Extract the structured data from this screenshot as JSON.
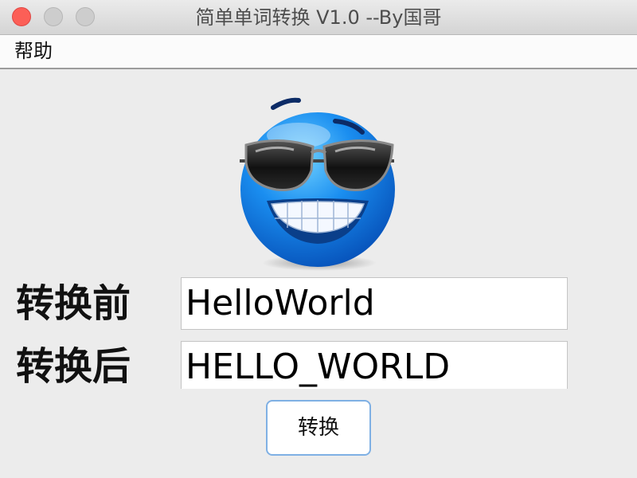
{
  "window": {
    "title": "简单单词转换 V1.0 --By国哥"
  },
  "menubar": {
    "items": [
      {
        "label": "帮助"
      }
    ]
  },
  "form": {
    "before_label": "转换前",
    "before_value": "HelloWorld",
    "after_label": "转换后",
    "after_value": "HELLO_WORLD",
    "convert_button": "转换"
  },
  "icons": {
    "mascot": "cool-sunglasses-smiley-icon"
  },
  "colors": {
    "close_button": "#fc5f57",
    "button_focus_border": "#7fb0e4",
    "mascot_blue": "#0a7fe0"
  }
}
